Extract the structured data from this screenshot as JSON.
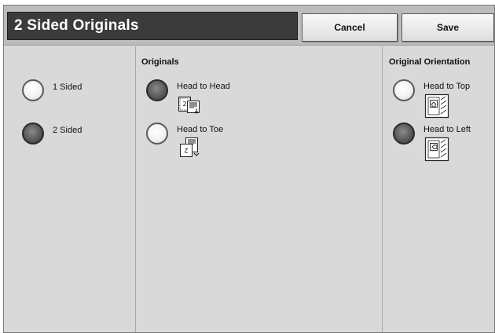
{
  "header": {
    "title": "2 Sided Originals",
    "cancel_label": "Cancel",
    "save_label": "Save"
  },
  "sides": {
    "options": [
      {
        "label": "1 Sided",
        "selected": false
      },
      {
        "label": "2 Sided",
        "selected": true
      }
    ]
  },
  "originals": {
    "heading": "Originals",
    "options": [
      {
        "label": "Head to Head",
        "selected": true,
        "icon": "head-to-head-icon"
      },
      {
        "label": "Head to Toe",
        "selected": false,
        "icon": "head-to-toe-icon"
      }
    ]
  },
  "orientation": {
    "heading": "Original Orientation",
    "options": [
      {
        "label": "Head to Top",
        "selected": false,
        "icon": "head-to-top-icon"
      },
      {
        "label": "Head to Left",
        "selected": true,
        "icon": "head-to-left-icon"
      }
    ]
  }
}
